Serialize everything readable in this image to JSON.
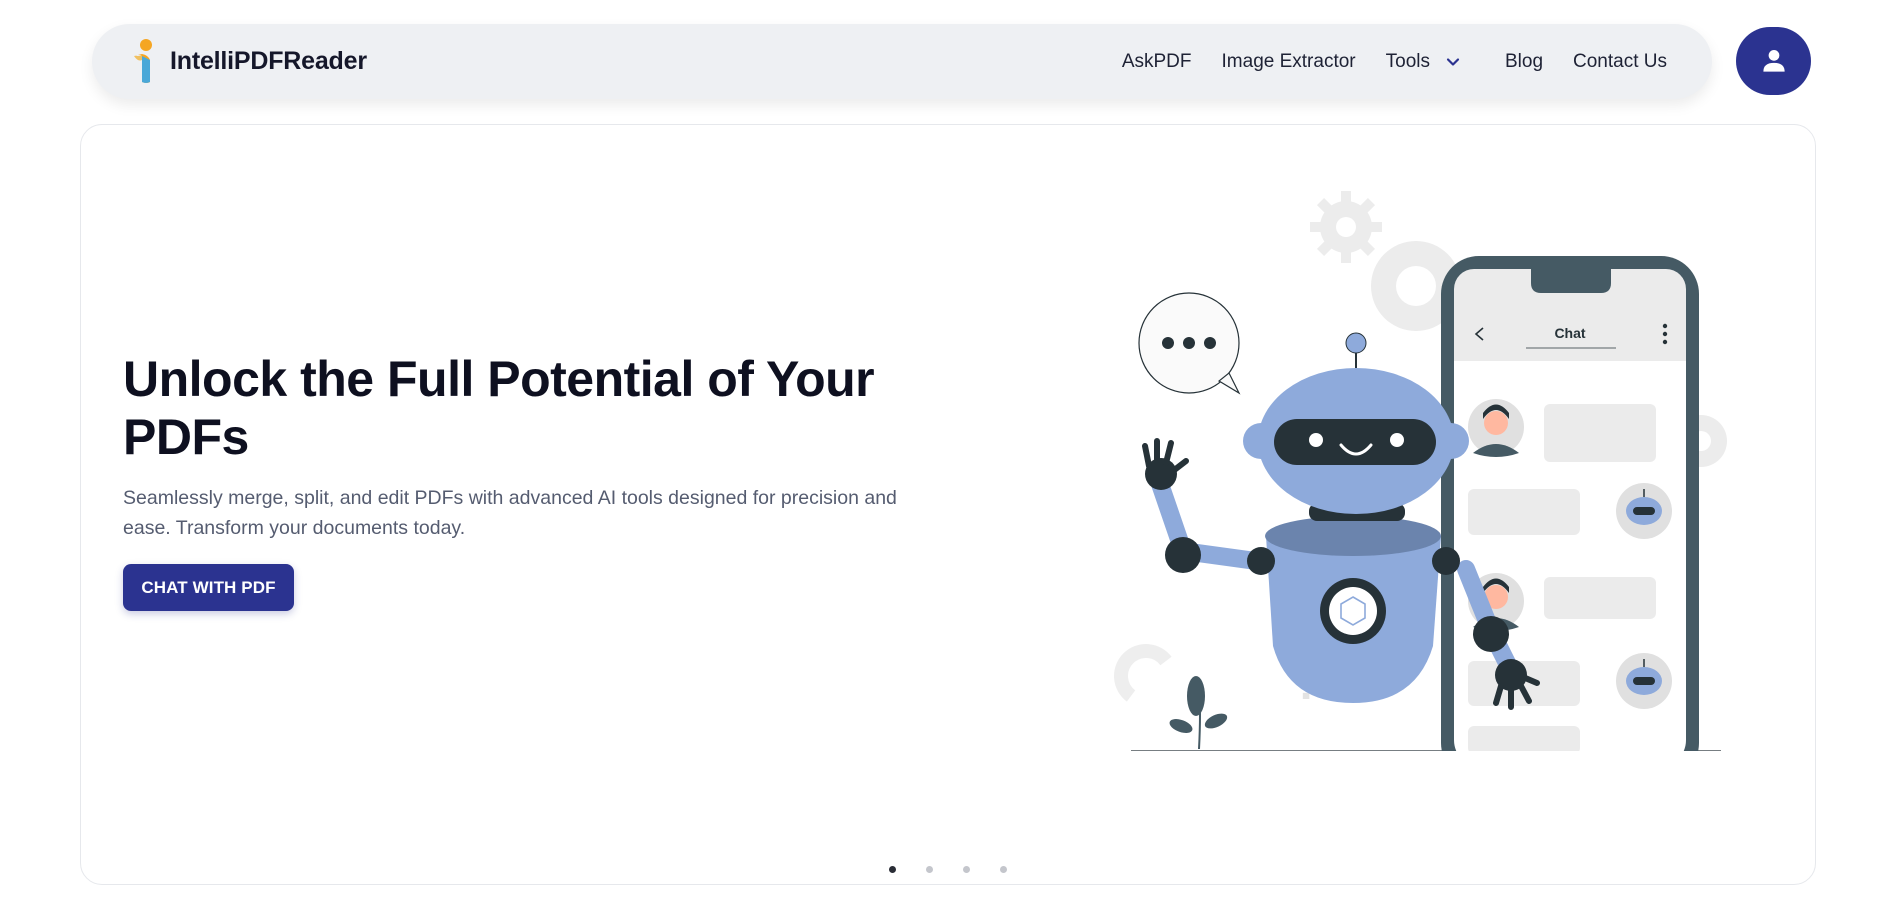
{
  "brand": {
    "name": "IntelliPDFReader",
    "accent": "#2b3390",
    "logo_colors": [
      "#f5a623",
      "#4aa8d8",
      "#2b3390"
    ]
  },
  "nav": {
    "items": [
      {
        "label": "AskPDF"
      },
      {
        "label": "Image Extractor"
      },
      {
        "label": "Tools",
        "has_dropdown": true,
        "icon": "chevron-down-icon"
      },
      {
        "label": "Blog"
      },
      {
        "label": "Contact Us"
      }
    ],
    "account_icon": "user-icon"
  },
  "hero": {
    "title": "Unlock the Full Potential of Your PDFs",
    "description": "Seamlessly merge, split, and edit PDFs with advanced AI tools designed for precision and ease. Transform your documents today.",
    "cta_label": "CHAT WITH PDF",
    "illustration": {
      "phone_header": "Chat",
      "colors": {
        "robot_blue": "#8eaadb",
        "dark": "#263238",
        "phone_frame": "#455a64"
      }
    }
  },
  "carousel": {
    "slide_count": 4,
    "active_index": 0
  }
}
